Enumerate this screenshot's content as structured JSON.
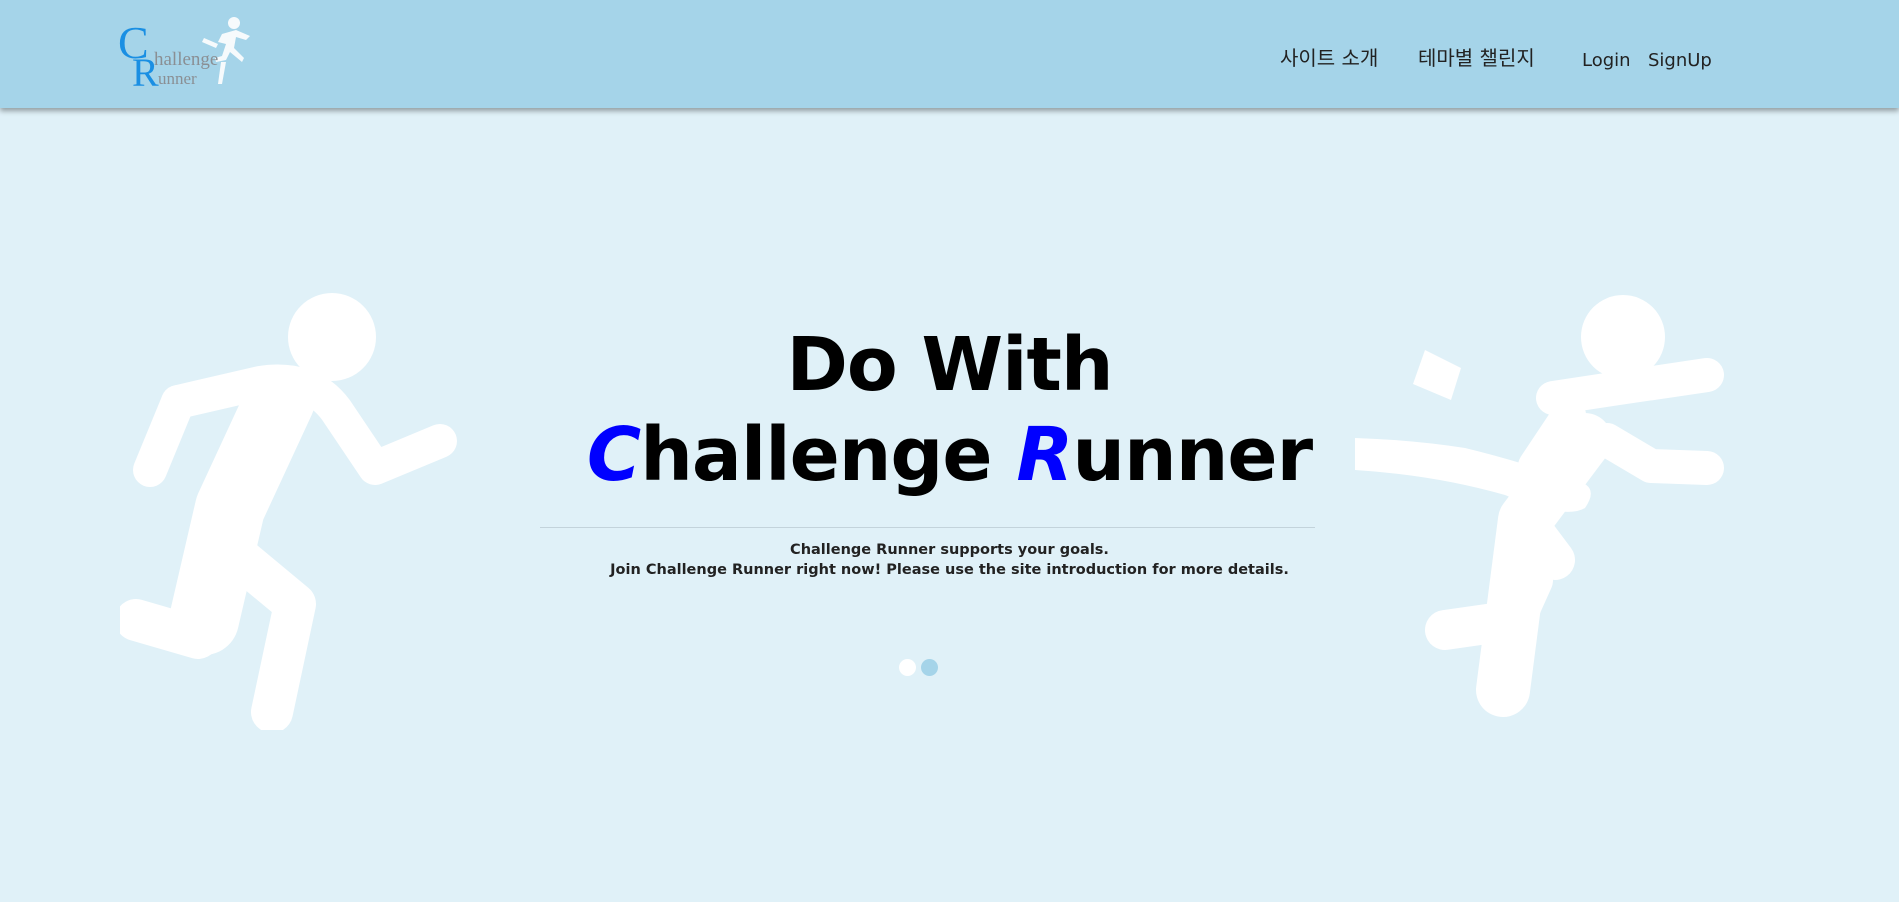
{
  "header": {
    "logo": {
      "letter_c": "C",
      "letter_r": "R",
      "word_1": "hallenge",
      "word_2": "unner",
      "icon": "runner-icon"
    },
    "nav": {
      "about": "사이트 소개",
      "theme_challenges": "테마별 챌린지",
      "login": "Login",
      "signup": "SignUp"
    }
  },
  "hero": {
    "headline_line1": "Do With",
    "headline_c": "C",
    "headline_hallenge": "hallenge ",
    "headline_r": "R",
    "headline_unner": "unner",
    "subtitle_1": "Challenge Runner supports your goals.",
    "subtitle_2": "Join Challenge Runner right now! Please use the site introduction for more details.",
    "left_figure": "running-person-icon",
    "right_figure": "finish-line-runner-icon"
  },
  "carousel": {
    "slides": 2,
    "active_index": 2
  },
  "colors": {
    "header_bg": "#a5d4e9",
    "page_bg": "#e0f1f8",
    "accent": "#0000ff",
    "dot_inactive": "#ffffff",
    "dot_active": "#a5d4e9"
  }
}
